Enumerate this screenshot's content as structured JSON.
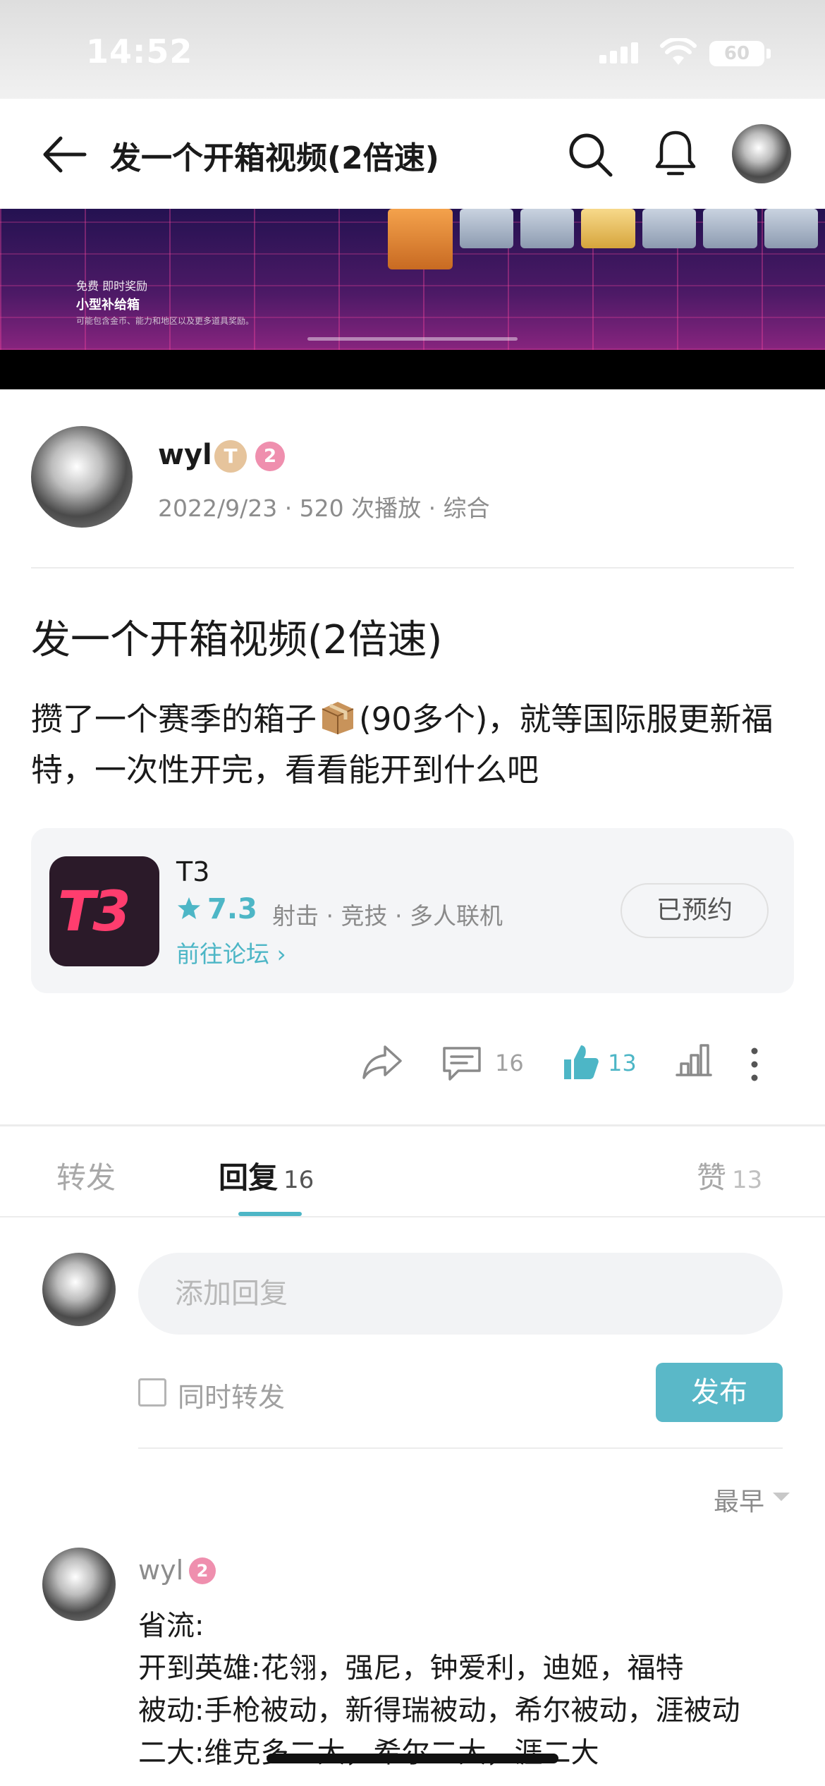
{
  "status_bar": {
    "time": "14:52",
    "battery": "60"
  },
  "header": {
    "title": "发一个开箱视频(2倍速)"
  },
  "video": {
    "label_tag": "免费  即时奖励",
    "label_title": "小型补给箱",
    "label_desc": "可能包含金币、能力和地区以及更多道具奖励。"
  },
  "author": {
    "name": "wyl",
    "badge_t": "T",
    "level": "2",
    "meta": "2022/9/23 · 520 次播放 · 综合"
  },
  "post": {
    "title": "发一个开箱视频(2倍速)",
    "body_part1": "攒了一个赛季的箱子",
    "body_part2": "(90多个)，就等国际服更新福特，一次性开完，看看能开到什么吧"
  },
  "game": {
    "logo_text": "T3",
    "name": "T3",
    "rating": "7.3",
    "tags": "射击 · 竞技 · 多人联机",
    "link": "前往论坛 ›",
    "button": "已预约"
  },
  "actions": {
    "comment_count": "16",
    "like_count": "13"
  },
  "tabs": {
    "forward": "转发",
    "reply": "回复",
    "reply_count": "16",
    "like": "赞",
    "like_count": "13"
  },
  "composer": {
    "placeholder": "添加回复",
    "repost_label": "同时转发",
    "publish": "发布"
  },
  "sort": {
    "label": "最早"
  },
  "comment": {
    "name": "wyl",
    "level": "2",
    "lines": [
      "省流:",
      "开到英雄:花翎，强尼，钟爱利，迪姬，福特",
      "被动:手枪被动，新得瑞被动，希尔被动，涯被动",
      "二大:维克多二大，希尔二大，涯二大"
    ]
  },
  "colors": {
    "accent": "#4db6c6",
    "level_badge": "#ef8fae",
    "game_logo": "#ff3d6e"
  }
}
